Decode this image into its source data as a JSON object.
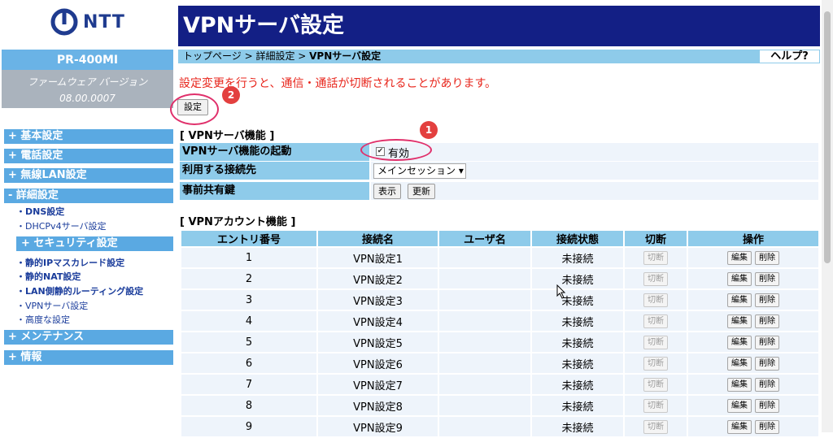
{
  "brand": {
    "logo_text": "NTT"
  },
  "device": {
    "model": "PR-400MI",
    "firmware_label": "ファームウェア バージョン",
    "firmware_version": "08.00.0007"
  },
  "menu": {
    "basic": "+ 基本設定",
    "phone": "+ 電話設定",
    "wlan": "+ 無線LAN設定",
    "detail": "- 詳細設定",
    "links": [
      "・DNS設定",
      "・DHCPv4サーバ設定"
    ],
    "security": "+ セキュリティ設定",
    "links2": [
      "・静的IPマスカレード設定",
      "・静的NAT設定",
      "・LAN側静的ルーティング設定",
      "・VPNサーバ設定",
      "・高度な設定"
    ],
    "maintenance": "+ メンテナンス",
    "info": "+ 情報"
  },
  "page": {
    "title": "VPNサーバ設定",
    "breadcrumb_prefix": "トップページ > 詳細設定 > ",
    "breadcrumb_current": "VPNサーバ設定",
    "help": "ヘルプ?",
    "warning": "設定変更を行うと、通信・通話が切断されることがあります。",
    "apply_button": "設定"
  },
  "vpn_server": {
    "section": "[ VPNサーバ機能 ]",
    "enable_label": "VPNサーバ機能の起動",
    "enable_checked": true,
    "enable_text": "有効",
    "connection_label": "利用する接続先",
    "connection_value": "メインセッション ▾",
    "psk_label": "事前共有鍵",
    "show_button": "表示",
    "renew_button": "更新"
  },
  "accounts": {
    "section": "[ VPNアカウント機能 ]",
    "headers": [
      "エントリ番号",
      "接続名",
      "ユーザ名",
      "接続状態",
      "切断",
      "操作"
    ],
    "rows": [
      {
        "no": "1",
        "name": "VPN設定1",
        "user": "",
        "status": "未接続"
      },
      {
        "no": "2",
        "name": "VPN設定2",
        "user": "",
        "status": "未接続"
      },
      {
        "no": "3",
        "name": "VPN設定3",
        "user": "",
        "status": "未接続"
      },
      {
        "no": "4",
        "name": "VPN設定4",
        "user": "",
        "status": "未接続"
      },
      {
        "no": "5",
        "name": "VPN設定5",
        "user": "",
        "status": "未接続"
      },
      {
        "no": "6",
        "name": "VPN設定6",
        "user": "",
        "status": "未接続"
      },
      {
        "no": "7",
        "name": "VPN設定7",
        "user": "",
        "status": "未接続"
      },
      {
        "no": "8",
        "name": "VPN設定8",
        "user": "",
        "status": "未接続"
      },
      {
        "no": "9",
        "name": "VPN設定9",
        "user": "",
        "status": "未接続"
      }
    ],
    "disconnect_label": "切断",
    "edit_label": "編集",
    "delete_label": "削除"
  },
  "annotations": {
    "step1": "1",
    "step2": "2",
    "ring_color": "#e0306b",
    "badge_color": "#e3403f"
  }
}
